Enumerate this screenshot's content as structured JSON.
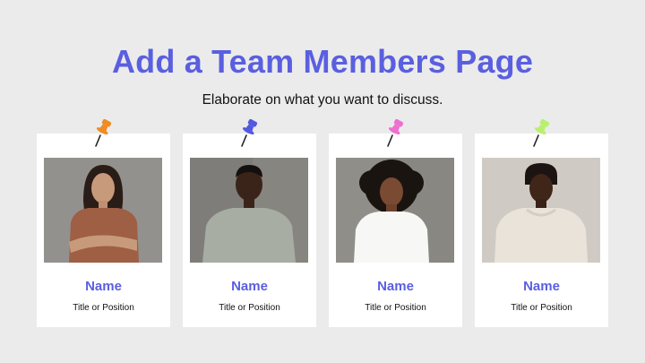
{
  "page": {
    "title": "Add a Team Members Page",
    "subtitle": "Elaborate on what you want to discuss."
  },
  "colors": {
    "background": "#ebebeb",
    "accent": "#5a5fe0",
    "card": "#ffffff"
  },
  "members": [
    {
      "name": "Name",
      "role": "Title or Position",
      "pin_color": "#f08a24",
      "pin_icon": "pushpin-icon",
      "photo_icon": "woman-portrait-photo"
    },
    {
      "name": "Name",
      "role": "Title or Position",
      "pin_color": "#5358e0",
      "pin_icon": "pushpin-icon",
      "photo_icon": "man-portrait-photo"
    },
    {
      "name": "Name",
      "role": "Title or Position",
      "pin_color": "#ee6fd0",
      "pin_icon": "pushpin-icon",
      "photo_icon": "woman-portrait-photo"
    },
    {
      "name": "Name",
      "role": "Title or Position",
      "pin_color": "#b9ef6f",
      "pin_icon": "pushpin-icon",
      "photo_icon": "man-portrait-photo"
    }
  ]
}
